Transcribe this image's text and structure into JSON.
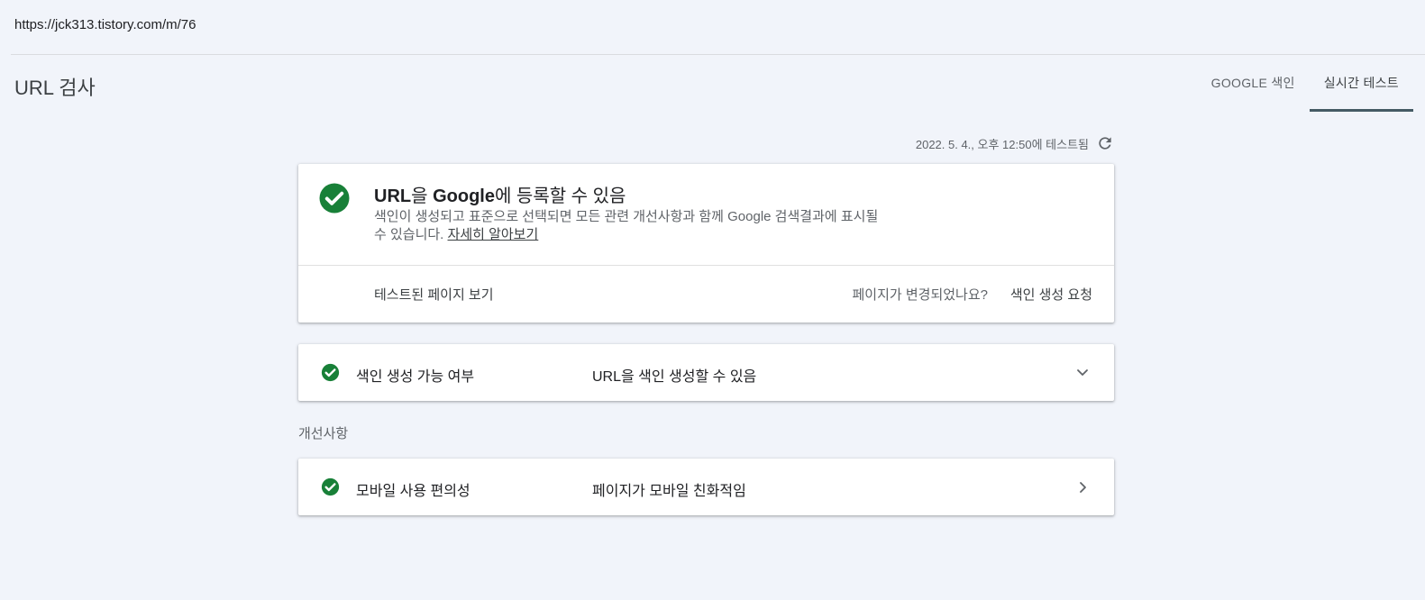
{
  "url": "https://jck313.tistory.com/m/76",
  "page_title": "URL 검사",
  "tabs": [
    {
      "label": "GOOGLE 색인",
      "active": false
    },
    {
      "label": "실시간 테스트",
      "active": true
    }
  ],
  "tested_at": "2022. 5. 4., 오후 12:50에 테스트됨",
  "status_card": {
    "title_part1": "URL",
    "title_part2": "을 ",
    "title_part3": "Google",
    "title_part4": "에 등록할 수 있음",
    "description": "색인이 생성되고 표준으로 선택되면 모든 관련 개선사항과 함께 Google 검색결과에 표시될 수 있습니다. ",
    "learn_more": "자세히 알아보기",
    "view_tested_page": "테스트된 페이지 보기",
    "page_changed_question": "페이지가 변경되었나요?",
    "request_indexing": "색인 생성 요청"
  },
  "indexability": {
    "label": "색인 생성 가능 여부",
    "value": "URL을 색인 생성할 수 있음"
  },
  "enhancements_label": "개선사항",
  "mobile_usability": {
    "label": "모바일 사용 편의성",
    "value": "페이지가 모바일 친화적임"
  },
  "colors": {
    "success_green": "#188038",
    "background": "#f1f4fa",
    "tab_indicator": "#455a64"
  },
  "icons": [
    "check-circle-icon",
    "refresh-icon",
    "chevron-down-icon",
    "chevron-right-icon"
  ]
}
